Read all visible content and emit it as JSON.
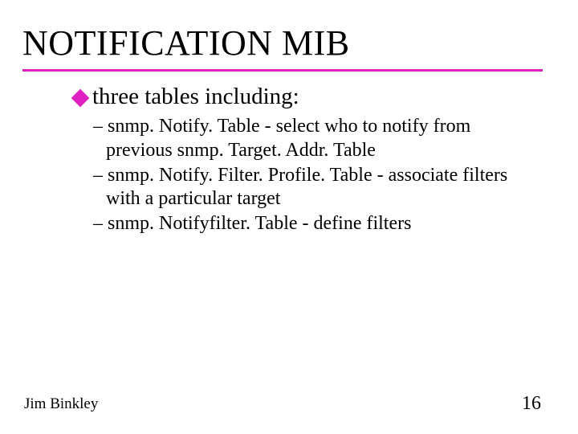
{
  "title": "NOTIFICATION MIB",
  "bullet": "three tables including:",
  "subitems": [
    "– snmp. Notify. Table - select who to notify from previous snmp. Target. Addr. Table",
    "– snmp. Notify. Filter. Profile. Table - associate filters with a particular target",
    "– snmp. Notifyfilter. Table - define filters"
  ],
  "footer_author": "Jim Binkley",
  "footer_page": "16",
  "accent_color": "#e020c0"
}
